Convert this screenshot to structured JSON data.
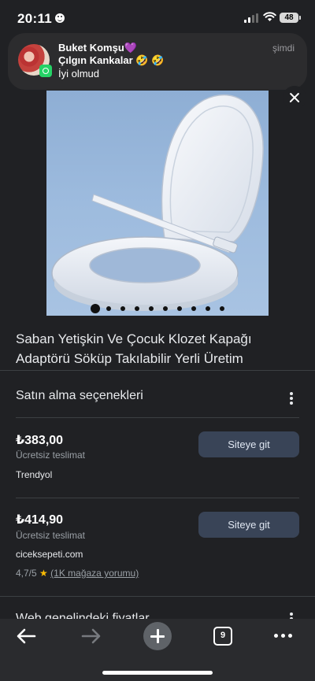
{
  "status_bar": {
    "time": "20:11",
    "battery": "48",
    "icons": [
      "smiley-icon",
      "signal-icon",
      "wifi-icon",
      "battery-icon"
    ]
  },
  "notification": {
    "sender": "Buket Komşu💜",
    "group": "Çılgın Kankalar 🤣 🤣",
    "message": "İyi olmud",
    "time": "şimdi",
    "app_icon": "whatsapp-icon"
  },
  "product": {
    "title": "Saban Yetişkin Ve Çocuk Klozet Kapağı Adaptörü Söküp Takılabilir Yerli Üretim",
    "image_count": 10,
    "active_image": 0
  },
  "purchase": {
    "section_title": "Satın alma seçenekleri",
    "offers": [
      {
        "price": "₺383,00",
        "shipping": "Ücretsiz teslimat",
        "seller": "Trendyol",
        "button": "Siteye git"
      },
      {
        "price": "₺414,90",
        "shipping": "Ücretsiz teslimat",
        "seller": "ciceksepeti.com",
        "button": "Siteye git",
        "rating": "4,7/5",
        "rating_link": "(1K mağaza yorumu)"
      }
    ]
  },
  "next_section_peek": "Web genelindeki fiyatlar",
  "toolbar": {
    "tab_count": "9",
    "icons": [
      "back-arrow-icon",
      "forward-arrow-icon",
      "new-tab-plus-icon",
      "tab-switcher-icon",
      "more-icon"
    ]
  },
  "colors": {
    "background": "#202124",
    "button": "#394457",
    "star": "#fbbc04"
  }
}
